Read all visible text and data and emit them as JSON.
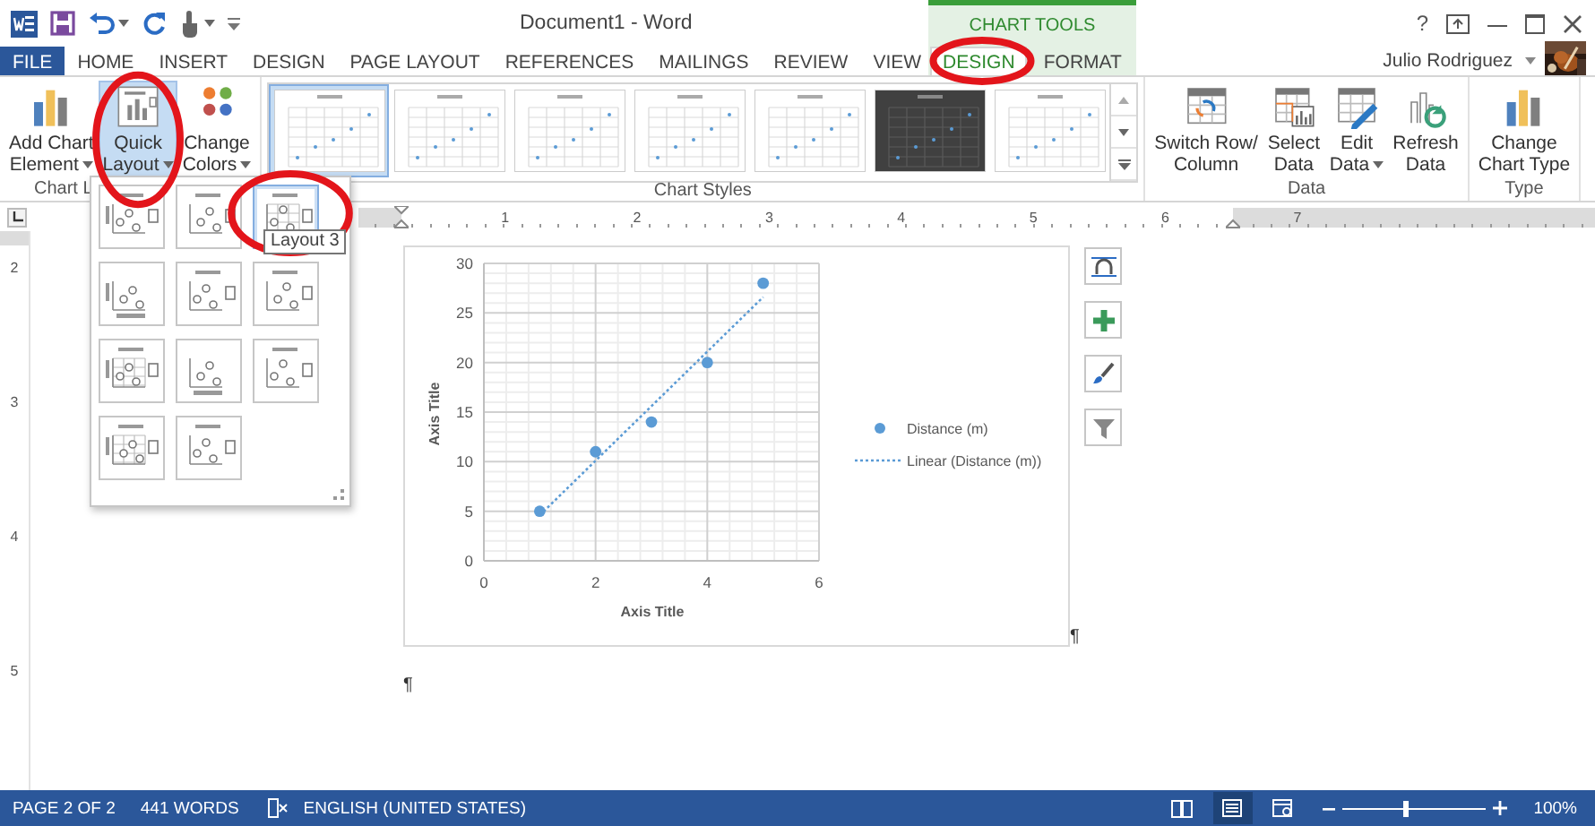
{
  "title_bar": {
    "title": "Document1 - Word",
    "help": "?"
  },
  "contextual_group": {
    "label": "CHART TOOLS"
  },
  "tabs": [
    {
      "label": "FILE",
      "kind": "file",
      "selected": false,
      "circled": false
    },
    {
      "label": "HOME",
      "kind": "standard",
      "selected": false,
      "circled": false
    },
    {
      "label": "INSERT",
      "kind": "standard",
      "selected": false,
      "circled": false
    },
    {
      "label": "DESIGN",
      "kind": "standard",
      "selected": false,
      "circled": false
    },
    {
      "label": "PAGE LAYOUT",
      "kind": "standard",
      "selected": false,
      "circled": false
    },
    {
      "label": "REFERENCES",
      "kind": "standard",
      "selected": false,
      "circled": false
    },
    {
      "label": "MAILINGS",
      "kind": "standard",
      "selected": false,
      "circled": false
    },
    {
      "label": "REVIEW",
      "kind": "standard",
      "selected": false,
      "circled": false
    },
    {
      "label": "VIEW",
      "kind": "standard",
      "selected": false,
      "circled": false
    },
    {
      "label": "DESIGN",
      "kind": "contextual",
      "selected": true,
      "circled": true
    },
    {
      "label": "FORMAT",
      "kind": "contextual",
      "selected": false,
      "circled": false
    }
  ],
  "account": {
    "name": "Julio Rodriguez"
  },
  "ribbon": {
    "groups": [
      {
        "label": "Chart L",
        "kind": "buttons",
        "buttons": [
          {
            "lines": [
              "Add Chart",
              "Element"
            ],
            "kind": "add-element",
            "dropdown": true,
            "selected": false,
            "circled": false
          },
          {
            "lines": [
              "Quick",
              "Layout"
            ],
            "kind": "quick-layout",
            "dropdown": true,
            "selected": true,
            "circled": true
          },
          {
            "lines": [
              "Change",
              "Colors"
            ],
            "kind": "colors",
            "dropdown": true,
            "selected": false,
            "circled": false
          }
        ]
      },
      {
        "label": "Chart Styles",
        "kind": "gallery",
        "styles": [
          {
            "kind": "light",
            "selected": true
          },
          {
            "kind": "light",
            "selected": false
          },
          {
            "kind": "light",
            "selected": false
          },
          {
            "kind": "light",
            "selected": false
          },
          {
            "kind": "light",
            "selected": false
          },
          {
            "kind": "dark",
            "selected": false
          },
          {
            "kind": "light",
            "selected": false
          }
        ]
      },
      {
        "label": "Data",
        "kind": "buttons",
        "buttons": [
          {
            "lines": [
              "Switch Row/",
              "Column"
            ],
            "kind": "switch",
            "dropdown": false,
            "selected": false,
            "circled": false
          },
          {
            "lines": [
              "Select",
              "Data"
            ],
            "kind": "select-data",
            "dropdown": false,
            "selected": false,
            "circled": false
          },
          {
            "lines": [
              "Edit",
              "Data"
            ],
            "kind": "edit-data",
            "dropdown": true,
            "selected": false,
            "circled": false
          },
          {
            "lines": [
              "Refresh",
              "Data"
            ],
            "kind": "refresh",
            "dropdown": false,
            "selected": false,
            "circled": false
          }
        ]
      },
      {
        "label": "Type",
        "kind": "buttons",
        "buttons": [
          {
            "lines": [
              "Change",
              "Chart Type"
            ],
            "kind": "chart-type",
            "dropdown": false,
            "selected": false,
            "circled": false
          }
        ]
      }
    ]
  },
  "quick_layout_menu": {
    "tooltip": "Layout 3",
    "items": [
      {
        "selected": false,
        "circled": false
      },
      {
        "selected": false,
        "circled": false
      },
      {
        "selected": true,
        "circled": true
      },
      {
        "selected": false,
        "circled": false
      },
      {
        "selected": false,
        "circled": false
      },
      {
        "selected": false,
        "circled": false
      },
      {
        "selected": false,
        "circled": false
      },
      {
        "selected": false,
        "circled": false
      },
      {
        "selected": false,
        "circled": false
      },
      {
        "selected": false,
        "circled": false
      },
      {
        "selected": false,
        "circled": false
      }
    ]
  },
  "rulers": {
    "horizontal": [
      "1",
      "2",
      "3",
      "4",
      "5",
      "6",
      "7"
    ],
    "vertical": [
      "2",
      "3",
      "4",
      "5"
    ]
  },
  "chart": {
    "chart_data": {
      "type": "scatter",
      "xlabel": "Axis Title",
      "ylabel": "Axis Title",
      "x": [
        1,
        2,
        3,
        4,
        5
      ],
      "series": [
        {
          "name": "Distance (m)",
          "color": "#5b9bd5",
          "values": [
            5,
            11,
            14,
            20,
            28
          ]
        },
        {
          "name": "Linear (Distance (m))",
          "color": "#5b9bd5",
          "type": "line",
          "line_style": "dotted",
          "values": [
            4.6,
            10.1,
            15.6,
            21.1,
            26.6
          ]
        }
      ],
      "xlim": [
        0,
        6
      ],
      "ylim": [
        0,
        30
      ],
      "xticks": [
        0,
        2,
        4,
        6
      ],
      "yticks": [
        0,
        5,
        10,
        15,
        20,
        25,
        30
      ],
      "grid": true,
      "legend": "right"
    }
  },
  "document": {
    "paragraph_marks": [
      "¶",
      "¶"
    ]
  },
  "status_bar": {
    "page": "PAGE 2 OF 2",
    "words": "441 WORDS",
    "language": "ENGLISH (UNITED STATES)",
    "views": [
      {
        "kind": "read",
        "selected": false
      },
      {
        "kind": "print",
        "selected": true
      },
      {
        "kind": "web",
        "selected": false
      }
    ],
    "zoom": {
      "level": 0.45,
      "reading": "100%"
    }
  }
}
